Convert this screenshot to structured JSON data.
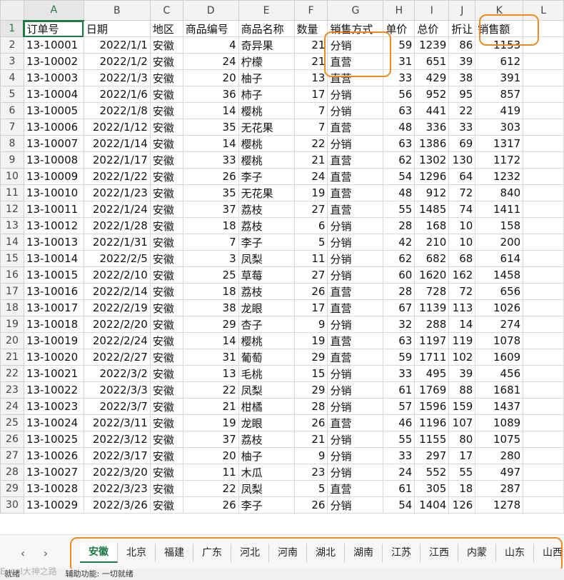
{
  "columns": [
    "A",
    "B",
    "C",
    "D",
    "E",
    "F",
    "G",
    "H",
    "I",
    "J",
    "K",
    "L"
  ],
  "header_row": {
    "num": "1",
    "cells": [
      "订单号",
      "日期",
      "地区",
      "商品编号",
      "商品名称",
      "数量",
      "销售方式",
      "单价",
      "总价",
      "折让",
      "销售额",
      ""
    ]
  },
  "rows": [
    {
      "num": "2",
      "cells": [
        "13-10001",
        "2022/1/1",
        "安徽",
        "4",
        "奇异果",
        "21",
        "分销",
        "59",
        "1239",
        "86",
        "1153",
        ""
      ]
    },
    {
      "num": "3",
      "cells": [
        "13-10002",
        "2022/1/2",
        "安徽",
        "24",
        "柠檬",
        "21",
        "直营",
        "31",
        "651",
        "39",
        "612",
        ""
      ]
    },
    {
      "num": "4",
      "cells": [
        "13-10003",
        "2022/1/3",
        "安徽",
        "20",
        "柚子",
        "13",
        "直营",
        "33",
        "429",
        "38",
        "391",
        ""
      ]
    },
    {
      "num": "5",
      "cells": [
        "13-10004",
        "2022/1/6",
        "安徽",
        "36",
        "柿子",
        "17",
        "分销",
        "56",
        "952",
        "95",
        "857",
        ""
      ]
    },
    {
      "num": "6",
      "cells": [
        "13-10005",
        "2022/1/8",
        "安徽",
        "14",
        "樱桃",
        "7",
        "分销",
        "63",
        "441",
        "22",
        "419",
        ""
      ]
    },
    {
      "num": "7",
      "cells": [
        "13-10006",
        "2022/1/12",
        "安徽",
        "35",
        "无花果",
        "7",
        "直营",
        "48",
        "336",
        "33",
        "303",
        ""
      ]
    },
    {
      "num": "8",
      "cells": [
        "13-10007",
        "2022/1/14",
        "安徽",
        "14",
        "樱桃",
        "22",
        "分销",
        "63",
        "1386",
        "69",
        "1317",
        ""
      ]
    },
    {
      "num": "9",
      "cells": [
        "13-10008",
        "2022/1/17",
        "安徽",
        "33",
        "樱桃",
        "21",
        "直营",
        "62",
        "1302",
        "130",
        "1172",
        ""
      ]
    },
    {
      "num": "10",
      "cells": [
        "13-10009",
        "2022/1/22",
        "安徽",
        "26",
        "李子",
        "24",
        "直营",
        "54",
        "1296",
        "64",
        "1232",
        ""
      ]
    },
    {
      "num": "11",
      "cells": [
        "13-10010",
        "2022/1/23",
        "安徽",
        "35",
        "无花果",
        "19",
        "直营",
        "48",
        "912",
        "72",
        "840",
        ""
      ]
    },
    {
      "num": "12",
      "cells": [
        "13-10011",
        "2022/1/24",
        "安徽",
        "37",
        "荔枝",
        "27",
        "直营",
        "55",
        "1485",
        "74",
        "1411",
        ""
      ]
    },
    {
      "num": "13",
      "cells": [
        "13-10012",
        "2022/1/28",
        "安徽",
        "18",
        "荔枝",
        "6",
        "分销",
        "28",
        "168",
        "10",
        "158",
        ""
      ]
    },
    {
      "num": "14",
      "cells": [
        "13-10013",
        "2022/1/31",
        "安徽",
        "7",
        "李子",
        "5",
        "分销",
        "42",
        "210",
        "10",
        "200",
        ""
      ]
    },
    {
      "num": "15",
      "cells": [
        "13-10014",
        "2022/2/5",
        "安徽",
        "3",
        "凤梨",
        "11",
        "分销",
        "62",
        "682",
        "68",
        "614",
        ""
      ]
    },
    {
      "num": "16",
      "cells": [
        "13-10015",
        "2022/2/10",
        "安徽",
        "25",
        "草莓",
        "27",
        "分销",
        "60",
        "1620",
        "162",
        "1458",
        ""
      ]
    },
    {
      "num": "17",
      "cells": [
        "13-10016",
        "2022/2/14",
        "安徽",
        "18",
        "荔枝",
        "26",
        "直营",
        "28",
        "728",
        "72",
        "656",
        ""
      ]
    },
    {
      "num": "18",
      "cells": [
        "13-10017",
        "2022/2/19",
        "安徽",
        "38",
        "龙眼",
        "17",
        "直营",
        "67",
        "1139",
        "113",
        "1026",
        ""
      ]
    },
    {
      "num": "19",
      "cells": [
        "13-10018",
        "2022/2/20",
        "安徽",
        "29",
        "杏子",
        "9",
        "分销",
        "32",
        "288",
        "14",
        "274",
        ""
      ]
    },
    {
      "num": "20",
      "cells": [
        "13-10019",
        "2022/2/24",
        "安徽",
        "14",
        "樱桃",
        "19",
        "直营",
        "63",
        "1197",
        "119",
        "1078",
        ""
      ]
    },
    {
      "num": "21",
      "cells": [
        "13-10020",
        "2022/2/27",
        "安徽",
        "31",
        "葡萄",
        "29",
        "直营",
        "59",
        "1711",
        "102",
        "1609",
        ""
      ]
    },
    {
      "num": "22",
      "cells": [
        "13-10021",
        "2022/3/2",
        "安徽",
        "13",
        "毛桃",
        "15",
        "分销",
        "33",
        "495",
        "39",
        "456",
        ""
      ]
    },
    {
      "num": "23",
      "cells": [
        "13-10022",
        "2022/3/3",
        "安徽",
        "22",
        "凤梨",
        "29",
        "分销",
        "61",
        "1769",
        "88",
        "1681",
        ""
      ]
    },
    {
      "num": "24",
      "cells": [
        "13-10023",
        "2022/3/7",
        "安徽",
        "21",
        "柑橘",
        "28",
        "分销",
        "57",
        "1596",
        "159",
        "1437",
        ""
      ]
    },
    {
      "num": "25",
      "cells": [
        "13-10024",
        "2022/3/11",
        "安徽",
        "19",
        "龙眼",
        "26",
        "直营",
        "46",
        "1196",
        "107",
        "1089",
        ""
      ]
    },
    {
      "num": "26",
      "cells": [
        "13-10025",
        "2022/3/12",
        "安徽",
        "37",
        "荔枝",
        "21",
        "分销",
        "55",
        "1155",
        "80",
        "1075",
        ""
      ]
    },
    {
      "num": "27",
      "cells": [
        "13-10026",
        "2022/3/17",
        "安徽",
        "20",
        "柚子",
        "9",
        "分销",
        "33",
        "297",
        "17",
        "280",
        ""
      ]
    },
    {
      "num": "28",
      "cells": [
        "13-10027",
        "2022/3/20",
        "安徽",
        "11",
        "木瓜",
        "23",
        "分销",
        "24",
        "552",
        "55",
        "497",
        ""
      ]
    },
    {
      "num": "29",
      "cells": [
        "13-10028",
        "2022/3/23",
        "安徽",
        "22",
        "凤梨",
        "5",
        "直营",
        "61",
        "305",
        "18",
        "287",
        ""
      ]
    },
    {
      "num": "30",
      "cells": [
        "13-10029",
        "2022/3/26",
        "安徽",
        "26",
        "李子",
        "26",
        "分销",
        "54",
        "1404",
        "126",
        "1278",
        ""
      ]
    }
  ],
  "sheet_tabs": [
    "安徽",
    "北京",
    "福建",
    "广东",
    "河北",
    "河南",
    "湖北",
    "湖南",
    "江苏",
    "江西",
    "内蒙",
    "山东",
    "山西"
  ],
  "active_tab": "安徽",
  "nav": {
    "prev": "‹",
    "next": "›"
  },
  "status": {
    "ready": "就绪",
    "accessibility": "辅助功能: 一切就绪"
  },
  "watermark": "Excel大神之路",
  "colors": {
    "accent": "#1f7a46",
    "highlight": "#ee8c22"
  }
}
